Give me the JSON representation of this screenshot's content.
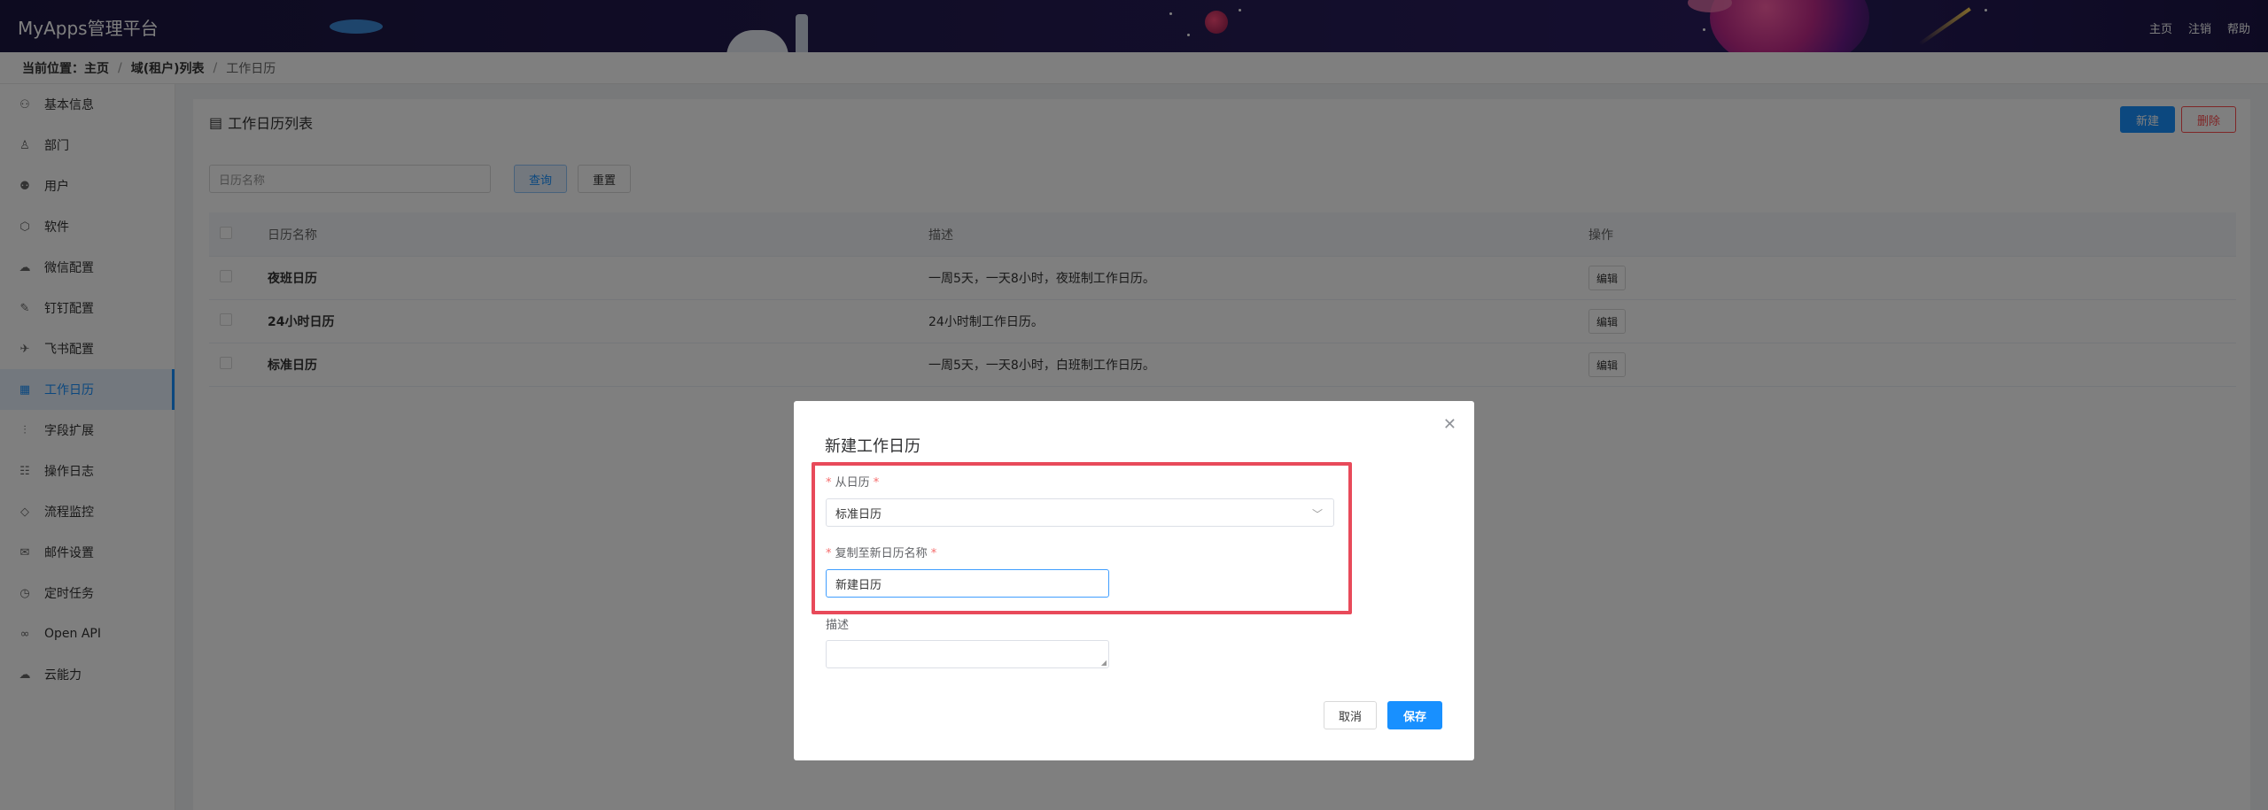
{
  "app": {
    "title": "MyApps管理平台"
  },
  "header_nav": [
    "主页",
    "注销",
    "帮助"
  ],
  "breadcrumb": {
    "prefix": "当前位置：",
    "items": [
      "主页",
      "域(租户)列表",
      "工作日历"
    ]
  },
  "sidebar": {
    "items": [
      {
        "label": "基本信息",
        "icon": "user-icon"
      },
      {
        "label": "部门",
        "icon": "org-icon"
      },
      {
        "label": "用户",
        "icon": "users-icon"
      },
      {
        "label": "软件",
        "icon": "cube-icon"
      },
      {
        "label": "微信配置",
        "icon": "wechat-icon"
      },
      {
        "label": "钉钉配置",
        "icon": "dingtalk-icon"
      },
      {
        "label": "飞书配置",
        "icon": "feishu-icon"
      },
      {
        "label": "工作日历",
        "icon": "calendar-icon",
        "active": true
      },
      {
        "label": "字段扩展",
        "icon": "sliders-icon"
      },
      {
        "label": "操作日志",
        "icon": "log-icon"
      },
      {
        "label": "流程监控",
        "icon": "diamond-icon"
      },
      {
        "label": "邮件设置",
        "icon": "mail-icon"
      },
      {
        "label": "定时任务",
        "icon": "timer-icon"
      },
      {
        "label": "Open API",
        "icon": "link-icon"
      },
      {
        "label": "云能力",
        "icon": "cloud-icon"
      }
    ]
  },
  "panel": {
    "title": "工作日历列表",
    "new_label": "新建",
    "delete_label": "删除",
    "search_placeholder": "日历名称",
    "query_label": "查询",
    "reset_label": "重置"
  },
  "table": {
    "headers": {
      "name": "日历名称",
      "desc": "描述",
      "op": "操作"
    },
    "rows": [
      {
        "name": "夜班日历",
        "desc": "一周5天，一天8小时，夜班制工作日历。",
        "op": "编辑"
      },
      {
        "name": "24小时日历",
        "desc": "24小时制工作日历。",
        "op": "编辑"
      },
      {
        "name": "标准日历",
        "desc": "一周5天，一天8小时，白班制工作日历。",
        "op": "编辑"
      }
    ]
  },
  "dialog": {
    "title": "新建工作日历",
    "from_label": "从日历",
    "from_value": "标准日历",
    "copy_label": "复制至新日历名称",
    "copy_value": "新建日历",
    "desc_label": "描述",
    "desc_value": "",
    "cancel_label": "取消",
    "save_label": "保存"
  },
  "colors": {
    "primary": "#1890ff",
    "danger": "#ff4d4f",
    "highlight": "#e84a5a",
    "header_bg": "#1b1640"
  }
}
